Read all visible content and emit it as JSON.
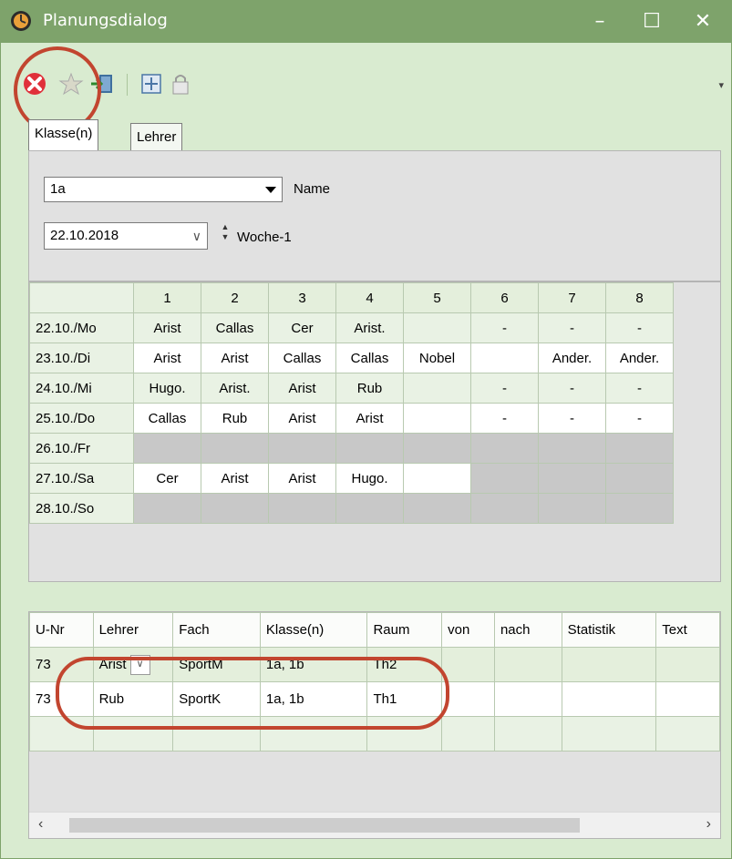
{
  "window": {
    "title": "Planungsdialog",
    "minimize": "–",
    "maximize": "☐",
    "close": "✕"
  },
  "toolbar": {
    "icons": [
      "delete-icon",
      "star-icon",
      "import-icon",
      "move-icon",
      "lock-icon"
    ],
    "overflow": "▾"
  },
  "tabs": [
    "Klasse(n)",
    "Lehrer"
  ],
  "filter": {
    "class_value": "1a",
    "class_label": "Name",
    "date_value": "22.10.2018",
    "date_chevron": "∨",
    "week_label": "Woche-1"
  },
  "timetable": {
    "columns": [
      "",
      "1",
      "2",
      "3",
      "4",
      "5",
      "6",
      "7",
      "8"
    ],
    "rows": [
      {
        "day": "22.10./Mo",
        "cells": [
          "Arist",
          "Callas",
          "Cer",
          "Arist.",
          "",
          "-",
          "-",
          "-"
        ],
        "styles": [
          "g",
          "g",
          "g",
          "g",
          "g",
          "g",
          "g",
          "g"
        ]
      },
      {
        "day": "23.10./Di",
        "cells": [
          "Arist",
          "Arist",
          "Callas",
          "Callas",
          "Nobel",
          "",
          "Ander.",
          "Ander."
        ],
        "styles": [
          "w",
          "w",
          "w",
          "w",
          "w",
          "w",
          "w",
          "w"
        ]
      },
      {
        "day": "24.10./Mi",
        "cells": [
          "Hugo.",
          "Arist.",
          "Arist",
          "Rub",
          "",
          "-",
          "-",
          "-"
        ],
        "styles": [
          "g",
          "g",
          "g",
          "g",
          "g",
          "g",
          "g",
          "g"
        ]
      },
      {
        "day": "25.10./Do",
        "cells": [
          "Callas",
          "Rub",
          "Arist",
          "Arist",
          "",
          "-",
          "-",
          "-"
        ],
        "styles": [
          "w",
          "w",
          "w",
          "w",
          "w",
          "w",
          "w",
          "w"
        ]
      },
      {
        "day": "26.10./Fr",
        "cells": [
          "",
          "",
          "",
          "",
          "",
          "",
          "",
          ""
        ],
        "styles": [
          "gray",
          "gray",
          "gray",
          "gray",
          "gray",
          "gray",
          "gray",
          "gray"
        ]
      },
      {
        "day": "27.10./Sa",
        "cells": [
          "Cer",
          "Arist",
          "Arist",
          "Hugo.",
          "",
          "",
          "",
          ""
        ],
        "styles": [
          "w",
          "w",
          "w",
          "w",
          "w",
          "gray",
          "gray",
          "gray"
        ]
      },
      {
        "day": "28.10./So",
        "cells": [
          "",
          "",
          "",
          "",
          "",
          "",
          "",
          ""
        ],
        "styles": [
          "gray",
          "gray",
          "gray",
          "gray",
          "gray",
          "gray",
          "gray",
          "gray"
        ]
      }
    ]
  },
  "lessons": {
    "columns": [
      "U-Nr",
      "Lehrer",
      "Fach",
      "Klasse(n)",
      "Raum",
      "von",
      "nach",
      "Statistik",
      "Text"
    ],
    "rows": [
      {
        "cells": [
          "73",
          "Arist",
          "SportM",
          "1a, 1b",
          "Th2",
          "",
          "",
          "",
          ""
        ],
        "style": "srow"
      },
      {
        "cells": [
          "73",
          "Rub",
          "SportK",
          "1a, 1b",
          "Th1",
          "",
          "",
          "",
          ""
        ],
        "style": "wrow"
      },
      {
        "cells": [
          "",
          "",
          "",
          "",
          "",
          "",
          "",
          "",
          ""
        ],
        "style": "erow"
      }
    ],
    "dropdown_glyph": "∨"
  },
  "scrollbar": {
    "left": "‹",
    "right": "›"
  },
  "colors": {
    "titlebar": "#7ea36b",
    "annotation": "#c2452f",
    "delete_icon": "#e0303a"
  }
}
